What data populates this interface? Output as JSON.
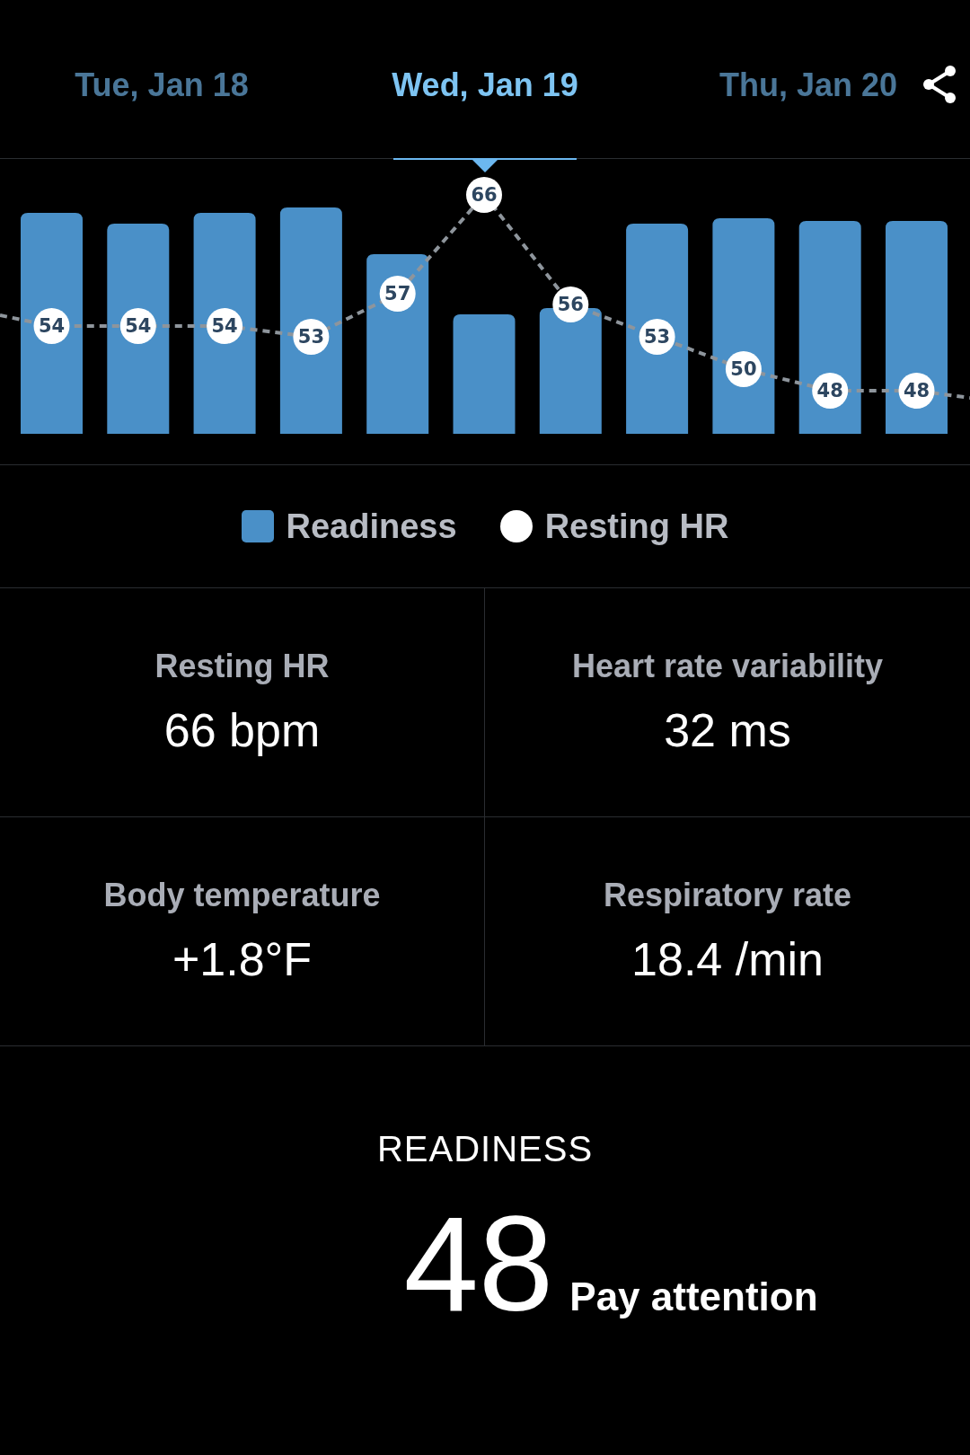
{
  "dates": [
    {
      "label": "Tue, Jan 18",
      "selected": false
    },
    {
      "label": "Wed, Jan 19",
      "selected": true
    },
    {
      "label": "Thu, Jan 20",
      "selected": false
    }
  ],
  "chart": {
    "point_labels": [
      "54",
      "54",
      "54",
      "53",
      "57",
      "66",
      "56",
      "53",
      "50",
      "48",
      "48"
    ]
  },
  "legend": [
    {
      "label": "Readiness",
      "kind": "square",
      "color": "#4a90c8"
    },
    {
      "label": "Resting HR",
      "kind": "circle",
      "color": "#ffffff"
    }
  ],
  "metrics": [
    {
      "label": "Resting HR",
      "value": "66 bpm"
    },
    {
      "label": "Heart rate variability",
      "value": "32 ms"
    },
    {
      "label": "Body temperature",
      "value": "+1.8°F"
    },
    {
      "label": "Respiratory rate",
      "value": "18.4 /min"
    }
  ],
  "readiness": {
    "title": "READINESS",
    "score": "48",
    "status": "Pay attention"
  }
}
